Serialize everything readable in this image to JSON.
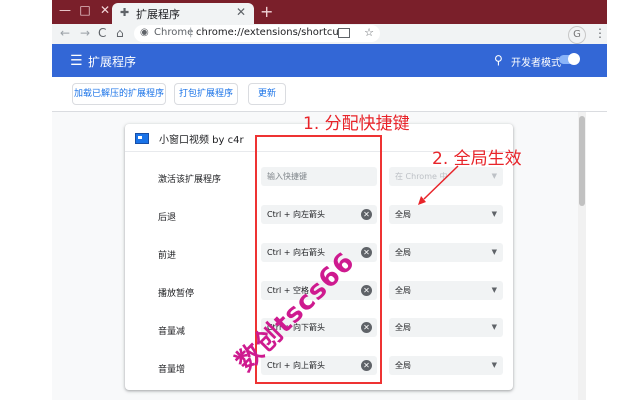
{
  "window": {
    "minimize": "—",
    "maximize": "□",
    "close": "✕"
  },
  "tab": {
    "title": "扩展程序",
    "close": "✕",
    "new_tab": "+"
  },
  "toolbar": {
    "back": "←",
    "forward": "→",
    "reload": "C",
    "home": "⌂",
    "scheme_label": "Chrome",
    "url": "chrome://extensions/shortcuts",
    "star": "☆"
  },
  "appbar": {
    "title": "扩展程序",
    "dev_mode_label": "开发者模式",
    "dev_mode_on": true
  },
  "actions": {
    "load_unpacked": "加载已解压的扩展程序",
    "pack": "打包扩展程序",
    "update": "更新"
  },
  "extension": {
    "name": "小窗口视频 by c4r"
  },
  "shortcuts": [
    {
      "label": "激活该扩展程序",
      "shortcut": "",
      "placeholder": "输入快捷键",
      "scope": "在 Chrome 中",
      "scope_disabled": true
    },
    {
      "label": "后退",
      "shortcut": "Ctrl + 向左箭头",
      "scope": "全局",
      "scope_disabled": false
    },
    {
      "label": "前进",
      "shortcut": "Ctrl + 向右箭头",
      "scope": "全局",
      "scope_disabled": false
    },
    {
      "label": "播放暂停",
      "shortcut": "Ctrl + 空格",
      "scope": "全局",
      "scope_disabled": false
    },
    {
      "label": "音量减",
      "shortcut": "Ctrl + 向下箭头",
      "scope": "全局",
      "scope_disabled": false
    },
    {
      "label": "音量增",
      "shortcut": "Ctrl + 向上箭头",
      "scope": "全局",
      "scope_disabled": false
    }
  ],
  "annotations": {
    "step1": "1. 分配快捷键",
    "step2": "2. 全局生效",
    "watermark": "数创tscs66"
  },
  "colors": {
    "titlebar": "#7a1f2a",
    "appbar": "#3367d6",
    "annotation": "#e8242a",
    "watermark": "#ce1a8f"
  }
}
